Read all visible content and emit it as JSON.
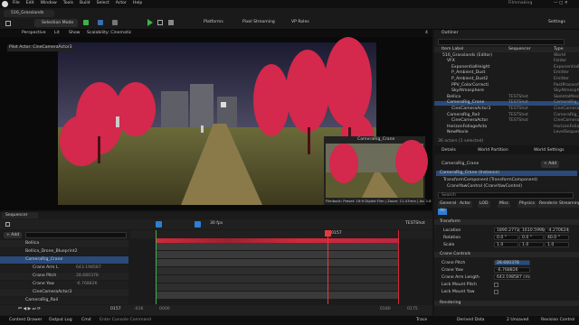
{
  "menu": [
    "File",
    "Edit",
    "Window",
    "Tools",
    "Build",
    "Select",
    "Actor",
    "Help"
  ],
  "project_tab": "516_Grasslands",
  "app_name": "Filmmaking",
  "toolbar": {
    "selection_mode": "Selection Mode",
    "platforms": "Platforms",
    "pixel_streaming": "Pixel Streaming",
    "vp_roles": "VP Roles",
    "settings": "Settings"
  },
  "viewport": {
    "perspective": "Perspective",
    "lit": "Lit",
    "show": "Show",
    "scalability": "Scalability: Cinematic",
    "pilot_actor": "Pilot Actor: CineCameraActor3",
    "speed": "4",
    "pip_title": "CameraRig_Crane",
    "pip_caption": "Filmback: Preset: 16:9 Digital Film | Zoom: 11.47mm | Av: 2.8"
  },
  "outliner": {
    "title": "Outliner",
    "col_label": "Item Label",
    "col_sequencer": "Sequencer",
    "col_type": "Type",
    "items": [
      {
        "label": "516_Grasslands (Editor)",
        "type": "World",
        "indent": 1
      },
      {
        "label": "VFX",
        "type": "Folder",
        "indent": 2
      },
      {
        "label": "ExponentialHeight",
        "type": "ExponentialH",
        "indent": 3
      },
      {
        "label": "P_Ambient_Dust",
        "type": "Emitter",
        "indent": 3
      },
      {
        "label": "P_Ambient_Dust2",
        "type": "Emitter",
        "indent": 3
      },
      {
        "label": "PPV_ColorCorrecti",
        "type": "PostProcessV",
        "indent": 3
      },
      {
        "label": "SkyAtmosphere",
        "type": "SkyAtmosphere",
        "indent": 3
      },
      {
        "label": "Bellica",
        "seq": "TESTShot",
        "type": "SkeletalMeshA",
        "indent": 2
      },
      {
        "label": "CameraRig_Crane",
        "seq": "TESTShot",
        "type": "CameraRig_Cr",
        "indent": 2,
        "selected": true
      },
      {
        "label": "CineCameraActor3",
        "seq": "TESTShot",
        "type": "CineCameraA",
        "indent": 3
      },
      {
        "label": "CameraRig_Rail",
        "seq": "TESTShot",
        "type": "CameraRig_Ra",
        "indent": 2
      },
      {
        "label": "CineCameraActor",
        "seq": "TESTShot",
        "type": "CineCameraA",
        "indent": 3
      },
      {
        "label": "HorizonFoliageActo",
        "type": "HorizonFolia",
        "indent": 2
      },
      {
        "label": "NewMovie",
        "type": "LevelSequen",
        "indent": 2
      }
    ],
    "count": "36 actors (1 selected)"
  },
  "details": {
    "tabs": [
      "Details",
      "World Partition",
      "World Settings"
    ],
    "object_name": "CameraRig_Crane",
    "add_label": "+ Add",
    "instance": "CameraRig_Crane (Instance)",
    "components": [
      "TransformComponent (TransformComponent)",
      "CraneYawControl (CraneYawControl)"
    ],
    "search_placeholder": "Search",
    "filter_tabs": [
      "General",
      "Actor",
      "LOD",
      "Misc",
      "Physics",
      "Rendering",
      "Streaming",
      "All"
    ],
    "section_transform": "Transform",
    "location_label": "Location",
    "location": [
      "1890.2773",
      "1610.5990",
      "-4.270624"
    ],
    "rotation_label": "Rotation",
    "rotation": [
      "0.0 °",
      "0.0 °",
      "40.0 °"
    ],
    "scale_label": "Scale",
    "scale": [
      "1.0",
      "1.0",
      "1.0"
    ],
    "section_crane": "Crane Controls",
    "crane_pitch_label": "Crane Pitch",
    "crane_pitch": "28.660378",
    "crane_yaw_label": "Crane Yaw",
    "crane_yaw": "-6.768826",
    "crane_arm_label": "Crane Arm Length",
    "crane_arm": "643.198587 cm",
    "lock_pitch_label": "Lock Mount Pitch",
    "lock_yaw_label": "Lock Mount Yaw",
    "section_rendering": "Rendering"
  },
  "sequencer": {
    "tab": "Sequencer",
    "fps": "30 fps",
    "shot": "TESTShot",
    "add_label": "+ Add",
    "current_frame": "0157",
    "frame_field": "0157",
    "tracks": [
      {
        "label": "Bellica",
        "indent": 1
      },
      {
        "label": "Bellica_Drone_Blueprint2",
        "indent": 1
      },
      {
        "label": "CameraRig_Crane",
        "indent": 1,
        "selected": true
      },
      {
        "label": "Crane Arm L",
        "value": "643.198587",
        "indent": 2
      },
      {
        "label": "Crane Pitch",
        "value": "28.660378",
        "indent": 2
      },
      {
        "label": "Crane Yaw",
        "value": "-6.768826",
        "indent": 2
      },
      {
        "label": "CineCameraActor3",
        "indent": 2
      },
      {
        "label": "CameraRig_Rail",
        "indent": 1
      }
    ],
    "start_marker": "-016",
    "end_marker": "0175",
    "start_frame": "0000",
    "end_frame": "0180"
  },
  "status": {
    "content_drawer": "Content Drawer",
    "output_log": "Output Log",
    "cmd": "Cmd",
    "console_placeholder": "Enter Console Command",
    "trace": "Trace",
    "derived_data": "Derived Data",
    "unsaved": "2 Unsaved",
    "revision_control": "Revision Control"
  },
  "colors": {
    "accent": "#2a7fd8",
    "keyframe_red": "#d4283a",
    "playhead": "#e33b3b",
    "green_play": "#3bb34a"
  }
}
